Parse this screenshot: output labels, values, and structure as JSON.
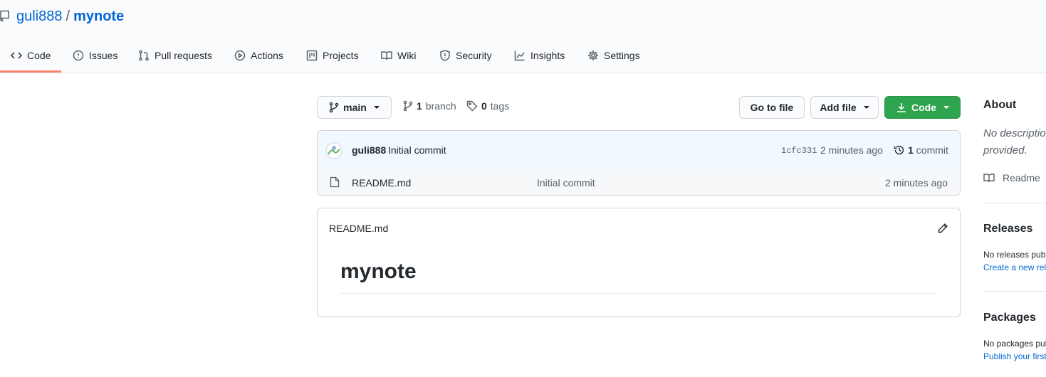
{
  "repo": {
    "owner": "guli888",
    "separator": "/",
    "name": "mynote"
  },
  "tabs": [
    {
      "label": "Code",
      "icon": "code-icon",
      "selected": true
    },
    {
      "label": "Issues",
      "icon": "issue-icon"
    },
    {
      "label": "Pull requests",
      "icon": "pull-request-icon"
    },
    {
      "label": "Actions",
      "icon": "play-icon"
    },
    {
      "label": "Projects",
      "icon": "project-icon"
    },
    {
      "label": "Wiki",
      "icon": "book-icon"
    },
    {
      "label": "Security",
      "icon": "shield-icon"
    },
    {
      "label": "Insights",
      "icon": "graph-icon"
    },
    {
      "label": "Settings",
      "icon": "gear-icon"
    }
  ],
  "toolbar": {
    "branch_button": "main",
    "branch_count": "1",
    "branch_label": "branch",
    "tag_count": "0",
    "tag_label": "tags",
    "go_to_file": "Go to file",
    "add_file": "Add file",
    "code_button": "Code"
  },
  "commit": {
    "author": "guli888",
    "message": "Initial commit",
    "sha": "1cfc331",
    "time": "2 minutes ago",
    "commit_count": "1",
    "commit_label": "commit"
  },
  "files": [
    {
      "name": "README.md",
      "message": "Initial commit",
      "time": "2 minutes ago"
    }
  ],
  "readme": {
    "filename": "README.md",
    "heading": "mynote"
  },
  "sidebar": {
    "about_title": "About",
    "about_desc_1": "No description,",
    "about_desc_2": "provided.",
    "readme_link": "Readme",
    "releases_title": "Releases",
    "releases_text": "No releases published",
    "releases_link": "Create a new release",
    "packages_title": "Packages",
    "packages_text": "No packages published",
    "packages_link": "Publish your first package"
  },
  "colors": {
    "accent_link": "#0366d6",
    "primary_button": "#2ea44f",
    "tab_underline": "#f9826c",
    "commit_row_bg": "#f1f8ff"
  }
}
